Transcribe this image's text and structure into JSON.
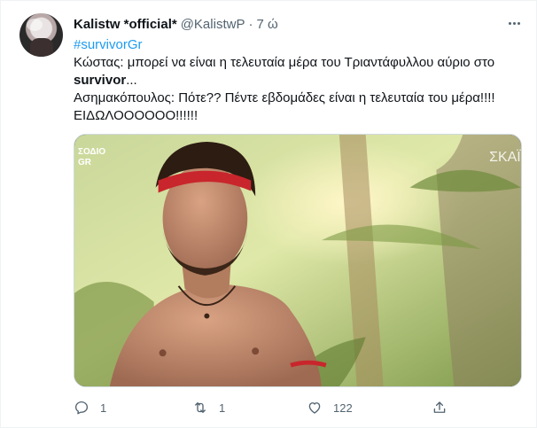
{
  "author": {
    "display_name": "Kalistw *official*",
    "handle": "@KalistwP",
    "separator": "·",
    "time": "7 ώ"
  },
  "tweet": {
    "hashtag": "#survivorGr",
    "line1": "Κώστας: μπορεί να είναι η τελευταία μέρα του Τριαντάφυλλου αύριο στο",
    "line2_bold": "survivor",
    "line2_rest": "...",
    "line3": "Ασημακόπουλος: Πότε?? Πέντε εβδομάδες είναι η τελευταία του μέρα!!!!",
    "line4": "ΕΙΔΩΛΟΟΟΟΟΟ!!!!!!"
  },
  "media": {
    "overlay_left_top": "ΣΟΔΙΟ",
    "overlay_left_bottom": "GR",
    "overlay_right": "ΣΚΑΪ"
  },
  "actions": {
    "reply_icon": "reply-icon",
    "reply_count": "1",
    "retweet_icon": "retweet-icon",
    "retweet_count": "1",
    "like_icon": "heart-icon",
    "like_count": "122",
    "share_icon": "share-icon"
  },
  "colors": {
    "link": "#1d9bf0",
    "muted": "#536471",
    "text": "#0f1419"
  }
}
